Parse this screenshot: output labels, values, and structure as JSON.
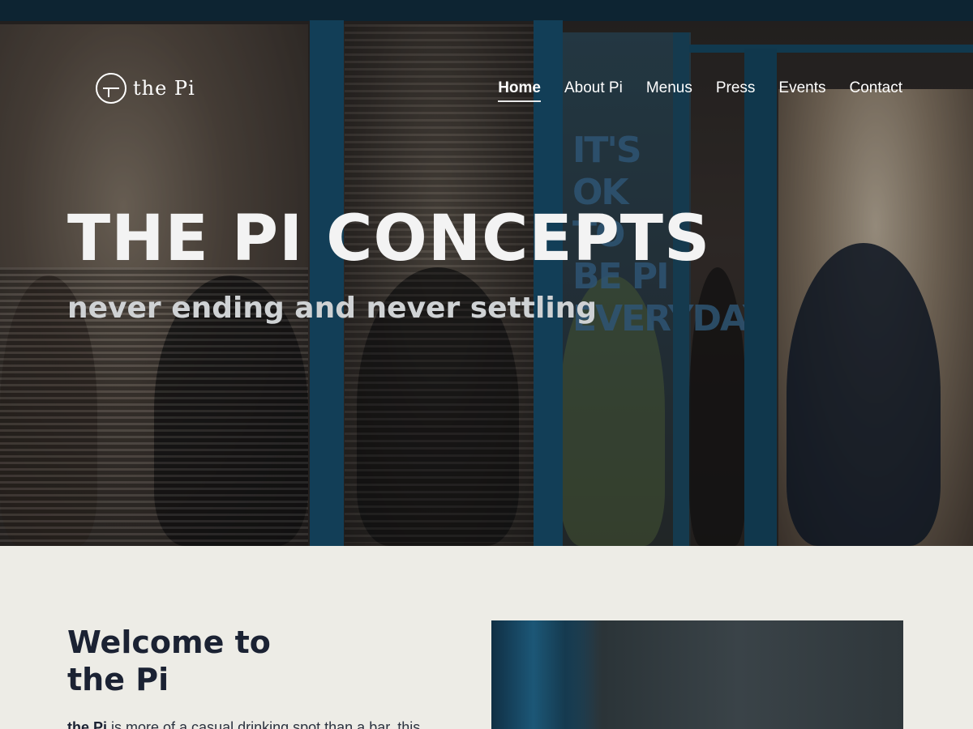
{
  "brand": {
    "name": "the Pi"
  },
  "nav": {
    "items": [
      {
        "label": "Home",
        "active": true
      },
      {
        "label": "About Pi",
        "active": false
      },
      {
        "label": "Menus",
        "active": false
      },
      {
        "label": "Press",
        "active": false
      },
      {
        "label": "Events",
        "active": false
      },
      {
        "label": "Contact",
        "active": false
      }
    ]
  },
  "hero": {
    "title": "THE PI CONCEPTS",
    "subtitle": "never ending and never settling",
    "window_sign": "IT'S OK TO BE PI EVERYDAY"
  },
  "welcome": {
    "title_line1": "Welcome to",
    "title_line2": "the Pi",
    "body_brand": "the Pi",
    "body_text": " is more of a casual drinking spot than a bar, this"
  },
  "colors": {
    "accent_blue": "#16506f",
    "page_bg": "#edece6",
    "heading_navy": "#1b2233"
  }
}
